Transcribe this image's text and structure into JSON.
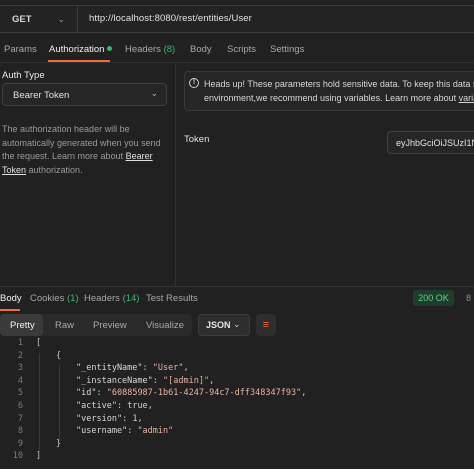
{
  "request": {
    "method": "GET",
    "url": "http://localhost:8080/rest/entities/User",
    "tabs": [
      {
        "label": "Params"
      },
      {
        "label": "Authorization"
      },
      {
        "label": "Headers",
        "count": "(8)"
      },
      {
        "label": "Body"
      },
      {
        "label": "Scripts"
      },
      {
        "label": "Settings"
      }
    ]
  },
  "auth": {
    "type_label": "Auth Type",
    "type_value": "Bearer Token",
    "description_pre": "The authorization header will be automatically generated when you send the request. Learn more about ",
    "description_link": "Bearer Token",
    "description_post": " authorization.",
    "warning_line1": "Heads up! These parameters hold sensitive data. To keep this data se",
    "warning_line2": "environment,we recommend using variables. Learn more about ",
    "warning_link": "variab",
    "token_label": "Token",
    "token_value": "eyJhbGciOiJSUzI1NiI"
  },
  "response": {
    "tabs": [
      {
        "label": "Body"
      },
      {
        "label": "Cookies",
        "count": "(1)"
      },
      {
        "label": "Headers",
        "count": "(14)"
      },
      {
        "label": "Test Results"
      }
    ],
    "status": "200 OK",
    "status_extra": "8",
    "formats": [
      "Pretty",
      "Raw",
      "Preview",
      "Visualize"
    ],
    "language": "JSON",
    "lines": [
      {
        "n": "1",
        "text": "["
      },
      {
        "n": "2",
        "text": "{"
      },
      {
        "n": "3",
        "key": "\"_entityName\"",
        "val": "\"User\"",
        "trail": ","
      },
      {
        "n": "4",
        "key": "\"_instanceName\"",
        "val": "\"[admin]\"",
        "trail": ","
      },
      {
        "n": "5",
        "key": "\"id\"",
        "val": "\"60885987-1b61-4247-94c7-dff348347f93\"",
        "trail": ","
      },
      {
        "n": "6",
        "key": "\"active\"",
        "val": "true",
        "trail": ","
      },
      {
        "n": "7",
        "key": "\"version\"",
        "val": "1",
        "trail": ","
      },
      {
        "n": "8",
        "key": "\"username\"",
        "val": "\"admin\"",
        "trail": ""
      },
      {
        "n": "9",
        "text": "}"
      },
      {
        "n": "10",
        "text": "]"
      }
    ]
  },
  "colors": {
    "accent": "#f26b3a",
    "success": "#5ad38a",
    "background": "#212121"
  },
  "icons": {
    "method_dropdown": "chevron-down-icon",
    "auth_dropdown": "chevron-down-icon",
    "warning": "info-circle-icon",
    "wrap": "wrap-lines-icon"
  }
}
